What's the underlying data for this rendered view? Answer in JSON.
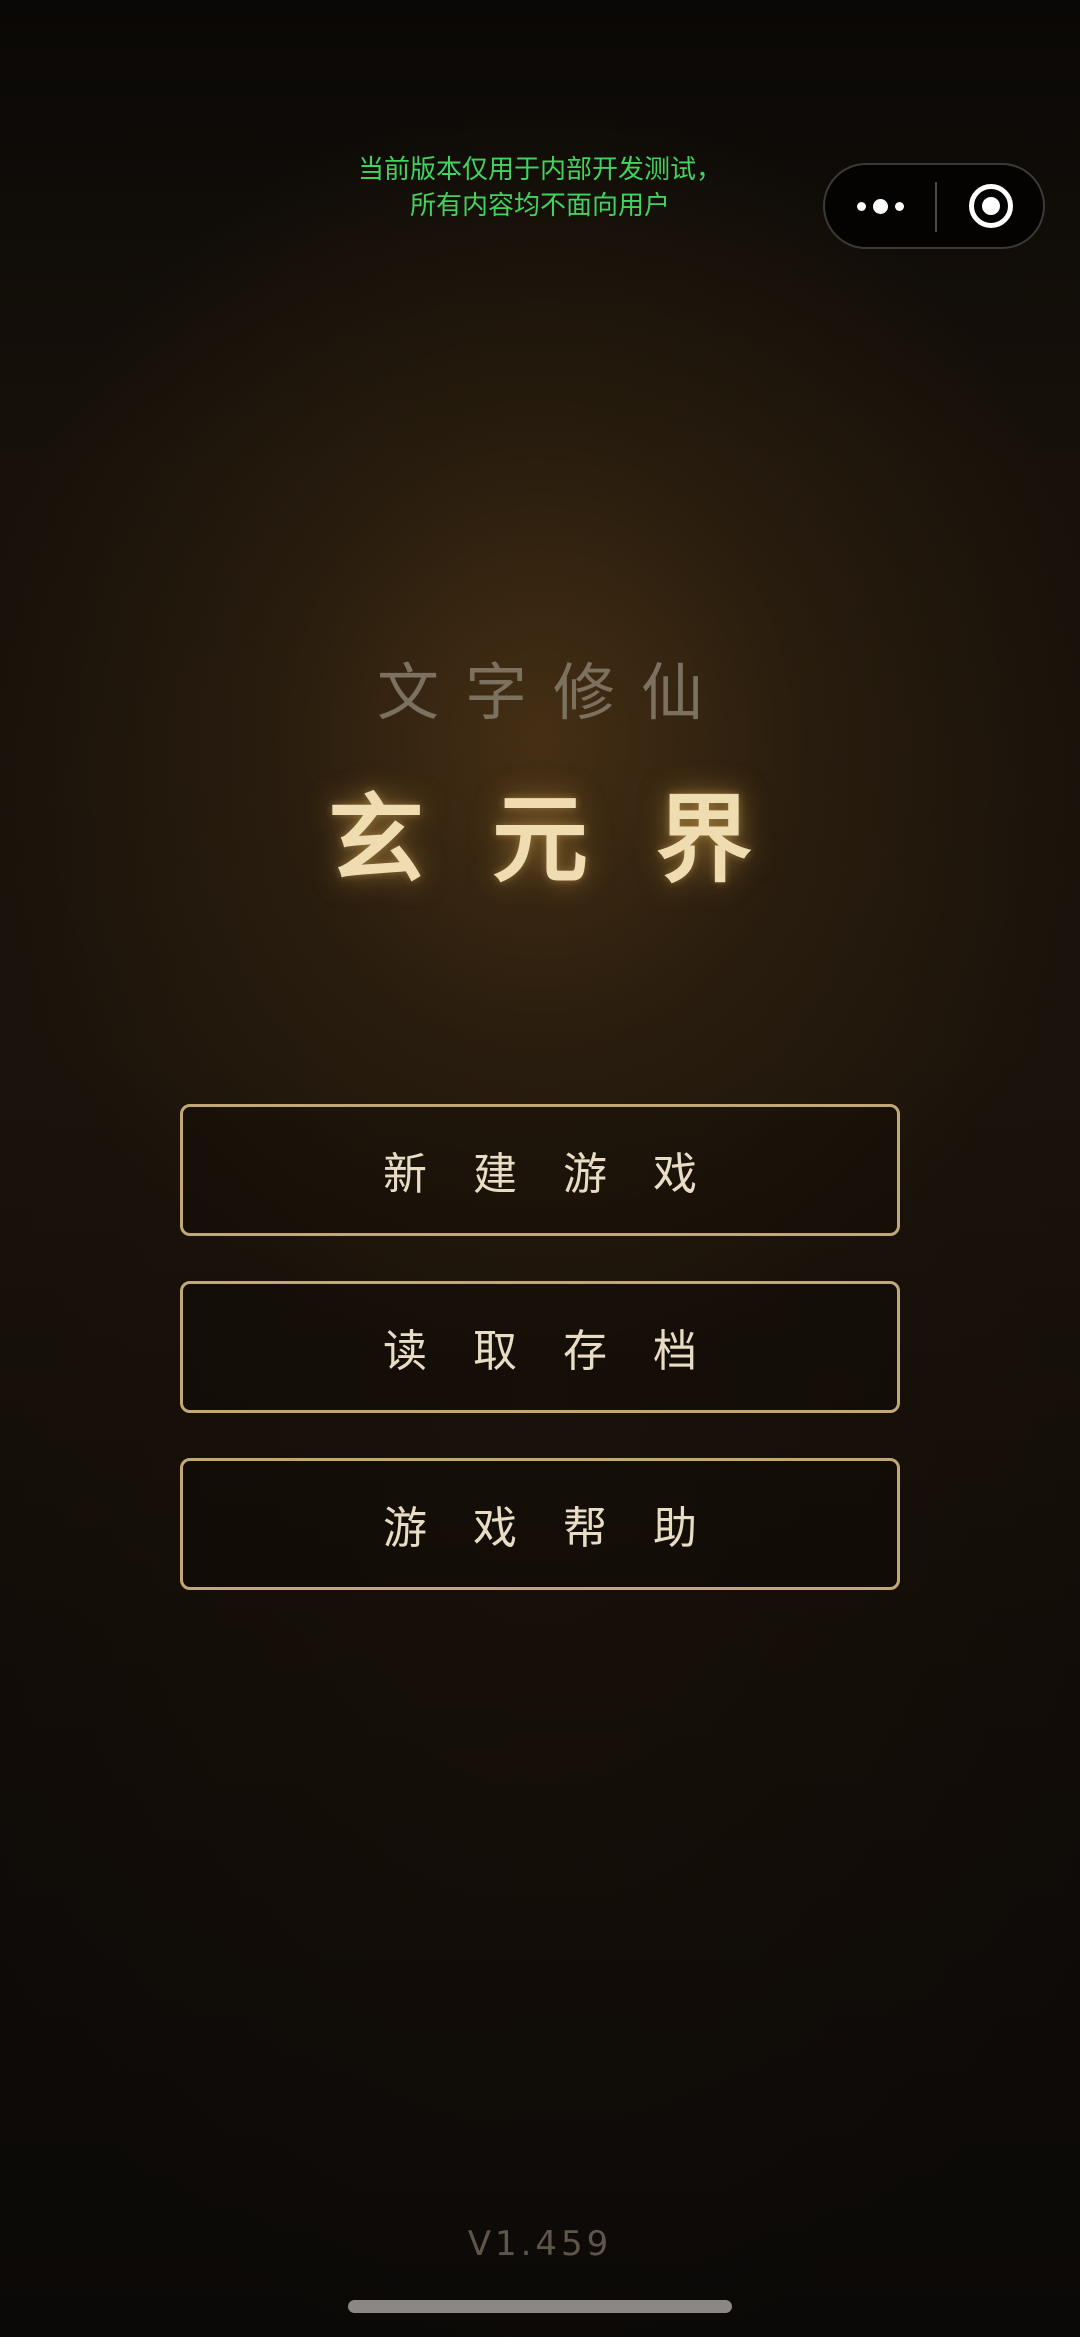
{
  "dev_notice": {
    "line1": "当前版本仅用于内部开发测试，",
    "line2": "所有内容均不面向用户"
  },
  "capsule": {
    "more_icon": "more-dots-icon",
    "close_icon": "target-circle-icon"
  },
  "header": {
    "subtitle": "文字修仙",
    "title": "玄元界"
  },
  "menu": {
    "new_game": "新建游戏",
    "load_save": "读取存档",
    "help": "游戏帮助"
  },
  "footer": {
    "version": "V1.459"
  },
  "colors": {
    "accent_gold": "#c2a877",
    "title_gold": "#efdcb0",
    "notice_green": "#42d25e"
  }
}
